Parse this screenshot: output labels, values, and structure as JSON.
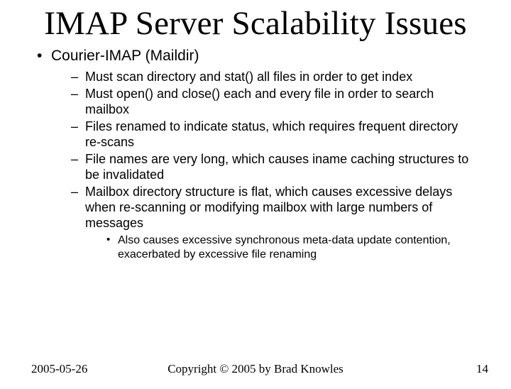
{
  "title": "IMAP Server Scalability Issues",
  "bullets": {
    "l1": "Courier-IMAP (Maildir)",
    "l2": [
      "Must scan directory and stat() all files in order to get index",
      "Must open() and close() each and every file in order to search mailbox",
      "Files renamed to indicate status, which requires frequent directory re-scans",
      "File names are very long, which causes iname caching structures to be invalidated",
      "Mailbox directory structure is flat, which causes excessive delays when re-scanning or modifying mailbox with large numbers of messages"
    ],
    "l3": [
      "Also causes excessive synchronous meta-data update contention, exacerbated by excessive file renaming"
    ]
  },
  "footer": {
    "date": "2005-05-26",
    "copyright": "Copyright © 2005 by Brad Knowles",
    "page": "14"
  }
}
